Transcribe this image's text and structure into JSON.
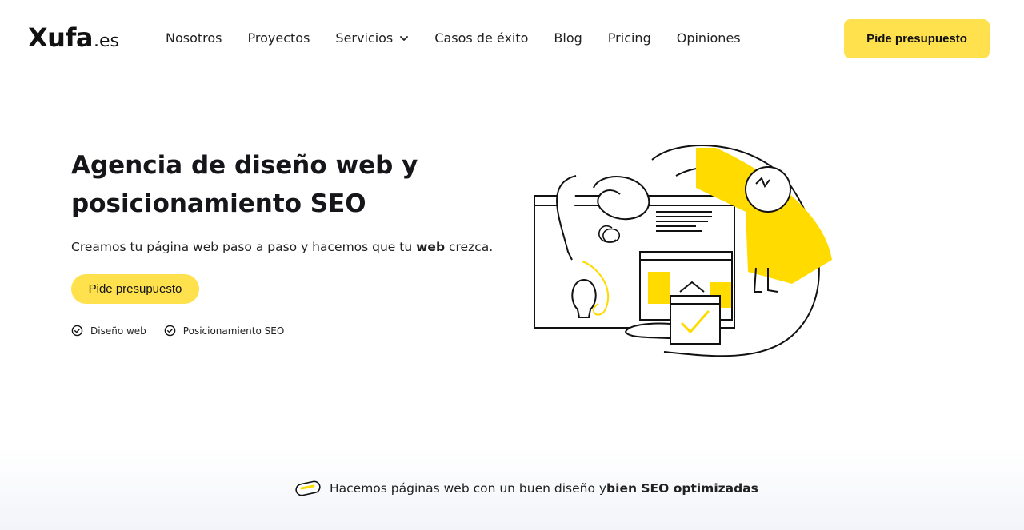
{
  "brand": {
    "name": "Xufa",
    "ext": ".es"
  },
  "nav": {
    "items": [
      {
        "label": "Nosotros"
      },
      {
        "label": "Proyectos"
      },
      {
        "label": "Servicios",
        "has_dropdown": true
      },
      {
        "label": "Casos de éxito"
      },
      {
        "label": "Blog"
      },
      {
        "label": "Pricing"
      },
      {
        "label": "Opiniones"
      }
    ],
    "cta_label": "Pide presupuesto"
  },
  "hero": {
    "title": "Agencia de diseño web y posicionamiento SEO",
    "subtitle_pre": "Creamos tu página web paso a paso y hacemos que tu ",
    "subtitle_bold": "web",
    "subtitle_post": " crezca.",
    "cta_label": "Pide presupuesto",
    "features": [
      {
        "label": "Diseño web",
        "icon": "check-circle-icon"
      },
      {
        "label": "Posicionamiento SEO",
        "icon": "check-circle-icon"
      }
    ]
  },
  "bottom": {
    "text_pre": "Hacemos páginas web con un buen diseño y ",
    "text_bold": "bien SEO optimizadas",
    "icon": "mouse-icon"
  },
  "colors": {
    "accent": "#ffe14d",
    "illustration_yellow": "#ffdb00",
    "text": "#1d1d1f"
  }
}
